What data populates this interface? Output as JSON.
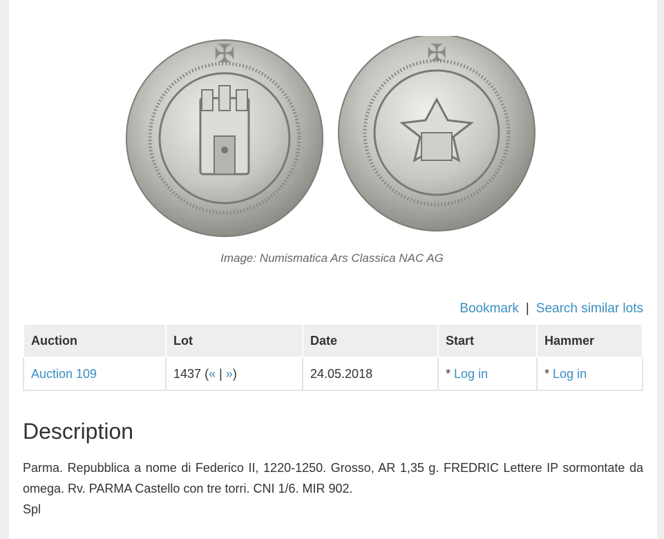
{
  "caption": "Image: Numismatica Ars Classica NAC AG",
  "actions": {
    "bookmark": "Bookmark",
    "separator": "|",
    "search_similar": "Search similar lots"
  },
  "table": {
    "headers": [
      "Auction",
      "Lot",
      "Date",
      "Start",
      "Hammer"
    ],
    "row": {
      "auction": "Auction 109",
      "lot_number": "1437",
      "lot_nav_open": "(",
      "lot_prev": "«",
      "lot_nav_sep": "|",
      "lot_next": "»",
      "lot_nav_close": ")",
      "date": "24.05.2018",
      "start_prefix": "*",
      "start_link": "Log in",
      "hammer_prefix": "*",
      "hammer_link": "Log in"
    }
  },
  "description": {
    "title": "Description",
    "text": "Parma. Repubblica a nome di Federico II, 1220-1250. Grosso, AR 1,35 g. FREDRIC Lettere IP sormontate da omega. Rv. PARMA Castello con tre torri. CNI 1/6. MIR 902.",
    "grade": "Spl"
  },
  "colors": {
    "link": "#3a8fc1",
    "header_bg": "#eeeeee",
    "page_bg": "#eeeeee",
    "silver": "#c8c8c4"
  },
  "icons": {
    "coin_image": "coin-photo-obverse-reverse"
  }
}
